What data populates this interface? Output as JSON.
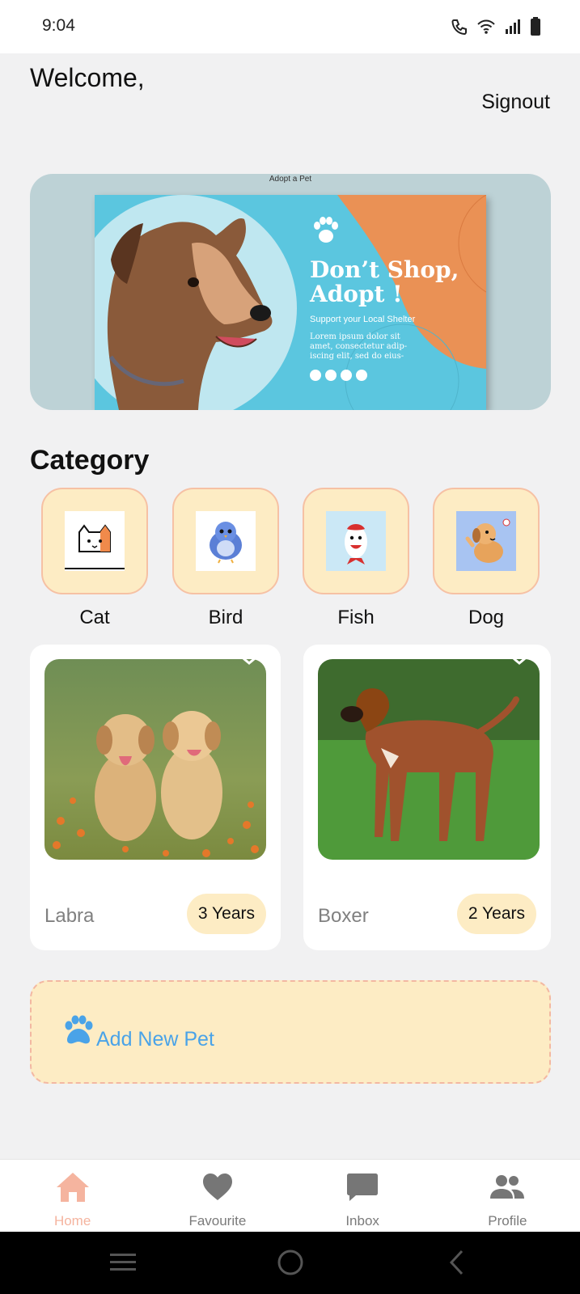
{
  "status_bar": {
    "time": "9:04"
  },
  "header": {
    "welcome": "Welcome,",
    "signout": "Signout"
  },
  "banner": {
    "caption": "Adopt a Pet",
    "headline": "Don’t Shop, Adopt !",
    "subline": "Support your Local Shelter",
    "body": "Lorem ipsum dolor sit amet, consectetur adip-iscing elit, sed do eius-"
  },
  "category": {
    "title": "Category",
    "items": [
      {
        "label": "Cat"
      },
      {
        "label": "Bird"
      },
      {
        "label": "Fish"
      },
      {
        "label": "Dog"
      }
    ]
  },
  "pets": [
    {
      "name": "Labra",
      "age": "3 Years"
    },
    {
      "name": "Boxer",
      "age": "2 Years"
    }
  ],
  "add_pet": {
    "label": "Add New Pet"
  },
  "bottom_nav": {
    "active": "Home",
    "items": [
      {
        "label": "Home",
        "icon": "home-icon"
      },
      {
        "label": "Favourite",
        "icon": "heart-icon"
      },
      {
        "label": "Inbox",
        "icon": "chat-icon"
      },
      {
        "label": "Profile",
        "icon": "people-icon"
      }
    ]
  },
  "colors": {
    "accent_peach": "#f5b49f",
    "tile_cream": "#fdecc4",
    "link_blue": "#4aa3e8",
    "background": "#f1f1f2"
  }
}
